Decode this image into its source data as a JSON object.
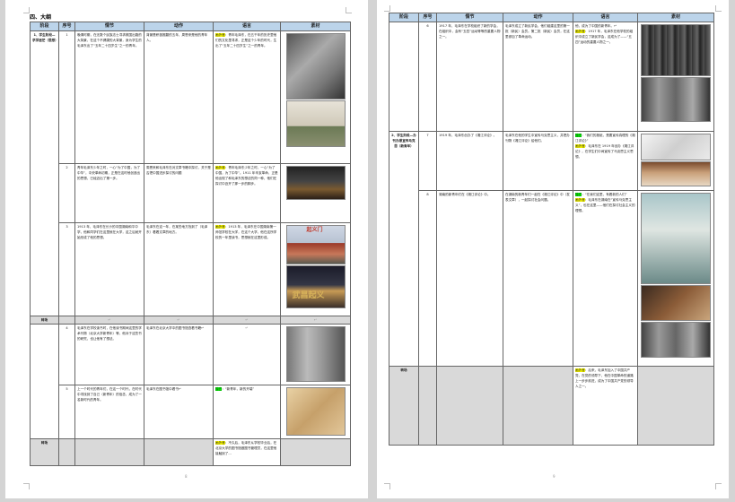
{
  "document": {
    "heading": "四、大纲",
    "columns": [
      "阶段",
      "序号",
      "情节",
      "动作",
      "语言",
      "素材"
    ],
    "mark": "↵",
    "left_page": {
      "stage1_label": "1、学生阶段—求学迷茫（思想）",
      "rows": [
        {
          "num": "1",
          "plot": "晚清时期，在无数个民族志士寻求救国出路的大背景，在这个不健康的大背景，身为学生的毛泽东出了“五年二十四岁生”之一的青年。",
          "action": "背景是积极推翻的五年，周恩来是他的青年人。",
          "lang_tag": "画外音",
          "lang_text": "：青年毛泽东，在五千年的历史里他们的文化里寻求，正是这个少年的时代，生出了“五年二十四岁生”之一的青年。",
          "pics": [
            "portrait",
            "gate"
          ]
        },
        {
          "num": "2",
          "plot": "青年毛泽东少年之时，一心“为了中国，为了中华”，中央革命初期，正是在这时他创造出的思想，已经迈出了第一步。",
          "action": "周恩来和毛泽东在对文章书籍中探讨，关于是否把中国进步探讨的问题",
          "lang_tag": "画外音",
          "lang_text": "：青年毛泽东少年之时，一心“为了中国，为了中华”。1911 年辛亥革命，正是他出现了和毛泽东的想法的同一种，他们在探讨中迈开了那一步的脚步。",
          "pics": [
            "dark"
          ]
        },
        {
          "num": "3",
          "plot": "1913 年，毛泽东在长沙的中国湖南和平中学，他和同学们在这里就在大学，这之后就开始形成了他的思想。",
          "action": "毛泽东在这一年，在某些地方找到了（毛泽东）看着文章的地方。",
          "lang_tag": "画外音",
          "lang_text": "：1913 年，毛泽东在中国湖南第一师范学校在大学，在这个大学，他在这所学校的一年里读书，思想就在这里形成。",
          "pics": [
            "tower",
            "night"
          ],
          "sign_text": "起义门",
          "badge_text": "武昌起义"
        }
      ],
      "sub_label": "转场",
      "sub_text": "↵",
      "rows_after": [
        {
          "num": "4",
          "plot": "毛泽东在学校读书时，在他读书期间这里的学术刊物（北京大学新青年）等，他对于这些书的研究，也让他有了想法。",
          "action": "毛泽东在北京大学中的图书馆查看书籍↵",
          "lang_tag": "",
          "lang_text": "↵",
          "pics": [
            "street"
          ]
        },
        {
          "num": "5",
          "plot": "上一个时代的青年们，在这一个时代，在时代中寻找到了自己（新青年）的信念，成为了一名新时代的青年。",
          "action": "毛泽东在图书馆中看书↵",
          "lang_tag": "独白",
          "lang_text": "：“新青年，新的开端”",
          "pics": [
            "paper"
          ]
        }
      ],
      "sub2_label": "转场",
      "sub2_tag": "画外音",
      "sub2_text": "：不久后，毛泽东从学校毕业后，在北京大学的图书馆做图书管理员，在这里他接触到了...",
      "page_no": "8"
    },
    "right_page": {
      "top_text": "他，成为了中国的新青年。↵",
      "rows": [
        {
          "num": "6",
          "plot": "1917 年，毛泽东在学校组织了新的学会，在组织中，会有“五四”运动等等的重要人物之一。",
          "action": "毛泽东成立了新民学会，他们组建这里的第一批（新民）会员。第二批（新民）会员，在这里参加了革命运动。",
          "lang_tag": "画外音",
          "lang_text": "：1917 年，毛泽东在他学校的组织中成立了新民学会，这成为了——“五四”运动的重要人物之一。",
          "pics": [
            "soldiers",
            "crowd"
          ]
        }
      ],
      "stage2_label": "2、学生阶段—办刊办报宣传马克思（新青年）",
      "rows2": [
        {
          "num": "7",
          "plot": "1919 年，毛泽东创办了《湘江评论》。",
          "action": "毛泽东在他的学生中宣传马克思主义，并把办刊物《湘江评论》给他们。",
          "lang_tag": "独白",
          "lang_text": "：“我们的报纸，是要宣传真理的《湘江评论》”",
          "lang_tag2": "画外音",
          "lang_text2": "：毛泽东在 1919 年创办《湘江评论》，在学生们中间宣传了马克思主义思想。",
          "pics": [
            "sketch",
            "classroom"
          ]
        },
        {
          "num": "8",
          "plot": "湖南的新青年们在《湘江评论》中。",
          "action": "在湖南的新青年们一起在《湘江评论》中（发表文章），一起探讨社会问题。",
          "lang_tag": "独白",
          "lang_text": "：“在我们这里，有着新的人们”",
          "lang_tag2": "画外音",
          "lang_text2": "：毛泽东在湖南在“宣传马克思主义”，也在这里——他们在探讨社会主义的理想。",
          "pics": [
            "woman",
            "reading",
            "crowd"
          ]
        }
      ],
      "sub_label": "转场",
      "sub_tag": "画外音",
      "sub_text": "：后来，毛泽东加入了中国共产党，在党的领导下，他在中国革命的道路上一步步前进，成为了中国共产党的领导人之一。",
      "page_no": "9"
    }
  }
}
